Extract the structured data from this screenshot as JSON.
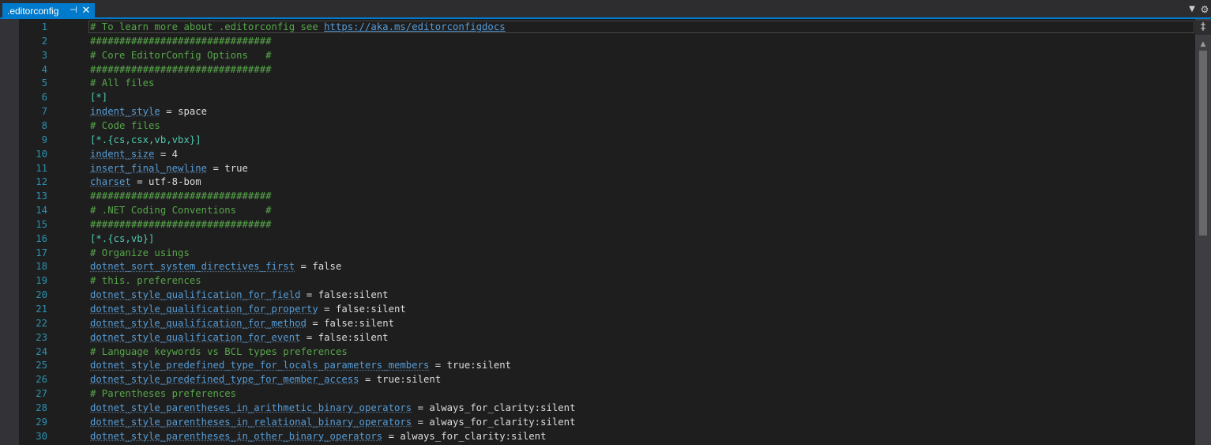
{
  "tab": {
    "title": ".editorconfig",
    "pin_icon": "pin-icon",
    "close_icon": "close-icon"
  },
  "window_controls": {
    "dropdown_icon": "chevron-down-icon",
    "split_icon": "split-editor-icon"
  },
  "colors": {
    "accent": "#007acc",
    "comment": "#57a64a",
    "key": "#569cd6",
    "section": "#4ec9b0",
    "line_number": "#2b91af",
    "text": "#dcdcdc",
    "background": "#1e1e1e"
  },
  "lines": [
    {
      "n": "1",
      "comment": "# To learn more about .editorconfig see ",
      "url": "https://aka.ms/editorconfigdocs"
    },
    {
      "n": "2",
      "comment": "###############################"
    },
    {
      "n": "3",
      "comment": "# Core EditorConfig Options   #"
    },
    {
      "n": "4",
      "comment": "###############################"
    },
    {
      "n": "5",
      "comment": "# All files"
    },
    {
      "n": "6",
      "section": "[*]"
    },
    {
      "n": "7",
      "key": "indent_style",
      "value": "space"
    },
    {
      "n": "8",
      "comment": "# Code files"
    },
    {
      "n": "9",
      "section": "[*.{cs,csx,vb,vbx}]"
    },
    {
      "n": "10",
      "key": "indent_size",
      "value": "4"
    },
    {
      "n": "11",
      "key": "insert_final_newline",
      "value": "true"
    },
    {
      "n": "12",
      "key": "charset",
      "value": "utf-8-bom"
    },
    {
      "n": "13",
      "comment": "###############################"
    },
    {
      "n": "14",
      "comment": "# .NET Coding Conventions     #"
    },
    {
      "n": "15",
      "comment": "###############################"
    },
    {
      "n": "16",
      "section": "[*.{cs,vb}]"
    },
    {
      "n": "17",
      "comment": "# Organize usings"
    },
    {
      "n": "18",
      "key": "dotnet_sort_system_directives_first",
      "value": "false"
    },
    {
      "n": "19",
      "comment": "# this. preferences"
    },
    {
      "n": "20",
      "key": "dotnet_style_qualification_for_field",
      "value": "false:silent"
    },
    {
      "n": "21",
      "key": "dotnet_style_qualification_for_property",
      "value": "false:silent"
    },
    {
      "n": "22",
      "key": "dotnet_style_qualification_for_method",
      "value": "false:silent"
    },
    {
      "n": "23",
      "key": "dotnet_style_qualification_for_event",
      "value": "false:silent"
    },
    {
      "n": "24",
      "comment": "# Language keywords vs BCL types preferences"
    },
    {
      "n": "25",
      "key": "dotnet_style_predefined_type_for_locals_parameters_members",
      "value": "true:silent"
    },
    {
      "n": "26",
      "key": "dotnet_style_predefined_type_for_member_access",
      "value": "true:silent"
    },
    {
      "n": "27",
      "comment": "# Parentheses preferences"
    },
    {
      "n": "28",
      "key": "dotnet_style_parentheses_in_arithmetic_binary_operators",
      "value": "always_for_clarity:silent"
    },
    {
      "n": "29",
      "key": "dotnet_style_parentheses_in_relational_binary_operators",
      "value": "always_for_clarity:silent"
    },
    {
      "n": "30",
      "key": "dotnet_style_parentheses_in_other_binary_operators",
      "value": "always_for_clarity:silent"
    }
  ]
}
